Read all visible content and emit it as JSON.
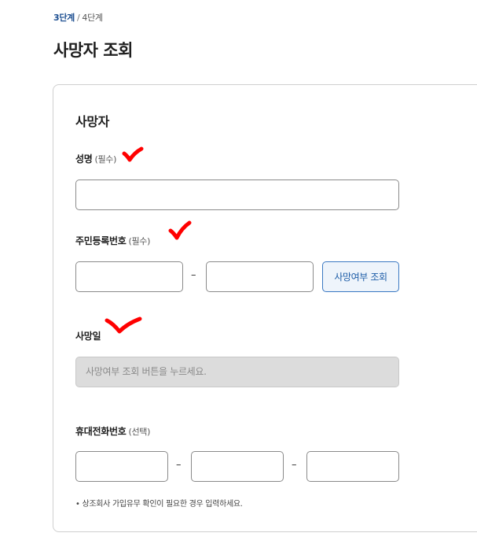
{
  "breadcrumb": {
    "current": "3단계",
    "separator": "/",
    "next": "4단계"
  },
  "page_title": "사망자 조회",
  "section": {
    "title": "사망자"
  },
  "name_field": {
    "label": "성명",
    "required": "(필수)",
    "value": ""
  },
  "rrn_field": {
    "label": "주민등록번호",
    "required": "(필수)",
    "part1": "",
    "part2": "",
    "separator": "–"
  },
  "lookup_button": {
    "label": "사망여부 조회"
  },
  "death_date_field": {
    "label": "사망일",
    "placeholder": "사망여부 조회 버튼을 누르세요."
  },
  "phone_field": {
    "label": "휴대전화번호",
    "optional": "(선택)",
    "separator": "–",
    "part1": "",
    "part2": "",
    "part3": ""
  },
  "help_text": "• 상조회사 가입유무 확인이 필요한 경우 입력하세요.",
  "annotation_color": "#ff0000"
}
